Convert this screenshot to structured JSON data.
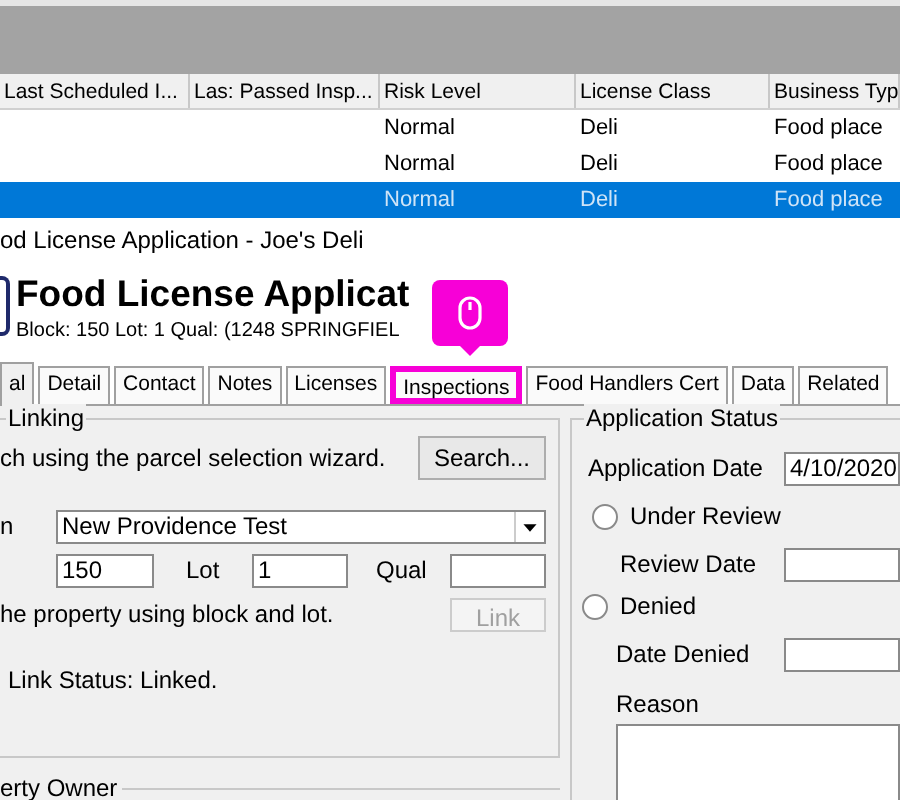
{
  "grid": {
    "columns": [
      "Last Scheduled I...",
      "Las: Passed Insp...",
      "Risk Level",
      "License Class",
      "Business Typ"
    ],
    "rows": [
      {
        "cells": [
          "",
          "",
          "Normal",
          "Deli",
          "Food place"
        ],
        "selected": false
      },
      {
        "cells": [
          "",
          "",
          "Normal",
          "Deli",
          "Food place"
        ],
        "selected": false
      },
      {
        "cells": [
          "",
          "",
          "Normal",
          "Deli",
          "Food place"
        ],
        "selected": true
      }
    ]
  },
  "window": {
    "title": "od License Application - Joe's Deli"
  },
  "header": {
    "title": "Food License Applicat",
    "subtitle": "Block: 150 Lot: 1 Qual:  (1248 SPRINGFIEL"
  },
  "tabs": [
    {
      "label": "al",
      "selected": true,
      "highlighted": false
    },
    {
      "label": "Detail",
      "selected": false,
      "highlighted": false
    },
    {
      "label": "Contact",
      "selected": false,
      "highlighted": false
    },
    {
      "label": "Notes",
      "selected": false,
      "highlighted": false
    },
    {
      "label": "Licenses",
      "selected": false,
      "highlighted": false
    },
    {
      "label": "Inspections",
      "selected": false,
      "highlighted": true
    },
    {
      "label": "Food Handlers Cert",
      "selected": false,
      "highlighted": false
    },
    {
      "label": "Data",
      "selected": false,
      "highlighted": false
    },
    {
      "label": "Related",
      "selected": false,
      "highlighted": false
    }
  ],
  "linking": {
    "title": "Linking",
    "hint": "ch using the parcel selection wizard.",
    "search_button": "Search...",
    "municipality_label": "n",
    "municipality": "New Providence Test",
    "block": "150",
    "lot_label": "Lot",
    "lot": "1",
    "qual_label": "Qual",
    "link_button": {
      "label": "Link",
      "disabled": true
    },
    "note": "he property using block and lot.",
    "status": "Link Status: Linked."
  },
  "owner": {
    "title": "erty Owner"
  },
  "status": {
    "title": "Application Status",
    "application_date_label": "Application Date",
    "application_date": "4/10/2020",
    "options": [
      {
        "label": "Under Review",
        "selected": false
      },
      {
        "label": "Denied",
        "selected": false
      }
    ],
    "review_date_label": "Review Date",
    "date_denied_label": "Date Denied",
    "reason_label": "Reason"
  }
}
